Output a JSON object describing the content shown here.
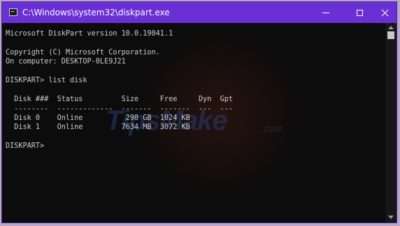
{
  "window": {
    "title": "C:\\Windows\\system32\\diskpart.exe",
    "icon": "console-app-icon",
    "controls": {
      "minimize_icon": "minimize-icon",
      "maximize_icon": "maximize-icon",
      "close_icon": "close-icon"
    },
    "colors": {
      "titlebar": "#6b2fd6",
      "console_bg": "#0c0c0c",
      "console_text": "#cccccc"
    }
  },
  "console": {
    "lines": [
      "Microsoft DiskPart version 10.0.19041.1",
      "",
      "Copyright (C) Microsoft Corporation.",
      "On computer: DESKTOP-0LE9J21",
      "",
      "DISKPART> list disk",
      "",
      "  Disk ###  Status         Size     Free     Dyn  Gpt",
      "  --------  -------------  -------  -------  ---  ---",
      "  Disk 0    Online          298 GB  1024 KB",
      "  Disk 1    Online         7634 MB  3072 KB",
      "",
      "DISKPART> "
    ]
  },
  "watermark": {
    "text": "TipsMake",
    "suffix": ".com"
  }
}
